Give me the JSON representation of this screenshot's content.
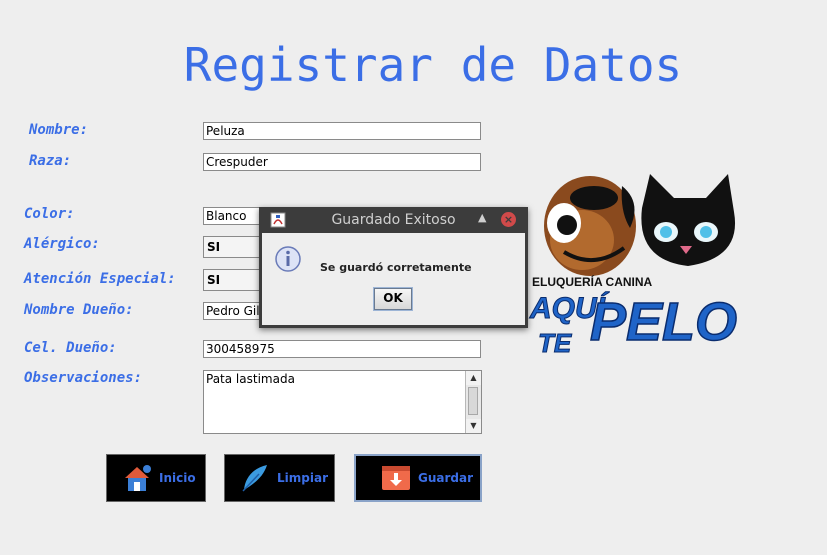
{
  "header": {
    "title": "Registrar de Datos"
  },
  "form": {
    "nombre_label": "Nombre:",
    "nombre_value": "Peluza",
    "raza_label": "Raza:",
    "raza_value": "Crespuder",
    "color_label": "Color:",
    "color_value": "Blanco",
    "alergico_label": "Alérgico:",
    "alergico_value": "SI",
    "atencion_label": "Atención Especial:",
    "atencion_value": "SI",
    "dueno_label": "Nombre Dueño:",
    "dueno_value": "Pedro Gil",
    "cel_label": "Cel. Dueño:",
    "cel_value": "300458975",
    "obs_label": "Observaciones:",
    "obs_value": "Pata lastimada"
  },
  "buttons": {
    "inicio": "Inicio",
    "limpiar": "Limpiar",
    "guardar": "Guardar"
  },
  "logo": {
    "top_text": "ELUQUERÍA  CANINA",
    "brand_line1": "AQUÍ",
    "brand_line2": "TE",
    "brand_word": "PELO"
  },
  "dialog": {
    "title": "Guardado Exitoso",
    "message": "Se guardó corretamente",
    "ok": "OK"
  },
  "colors": {
    "accent": "#3b6ee6",
    "dialog_bar": "#3c3c3c",
    "close_button": "#d04a4a"
  }
}
